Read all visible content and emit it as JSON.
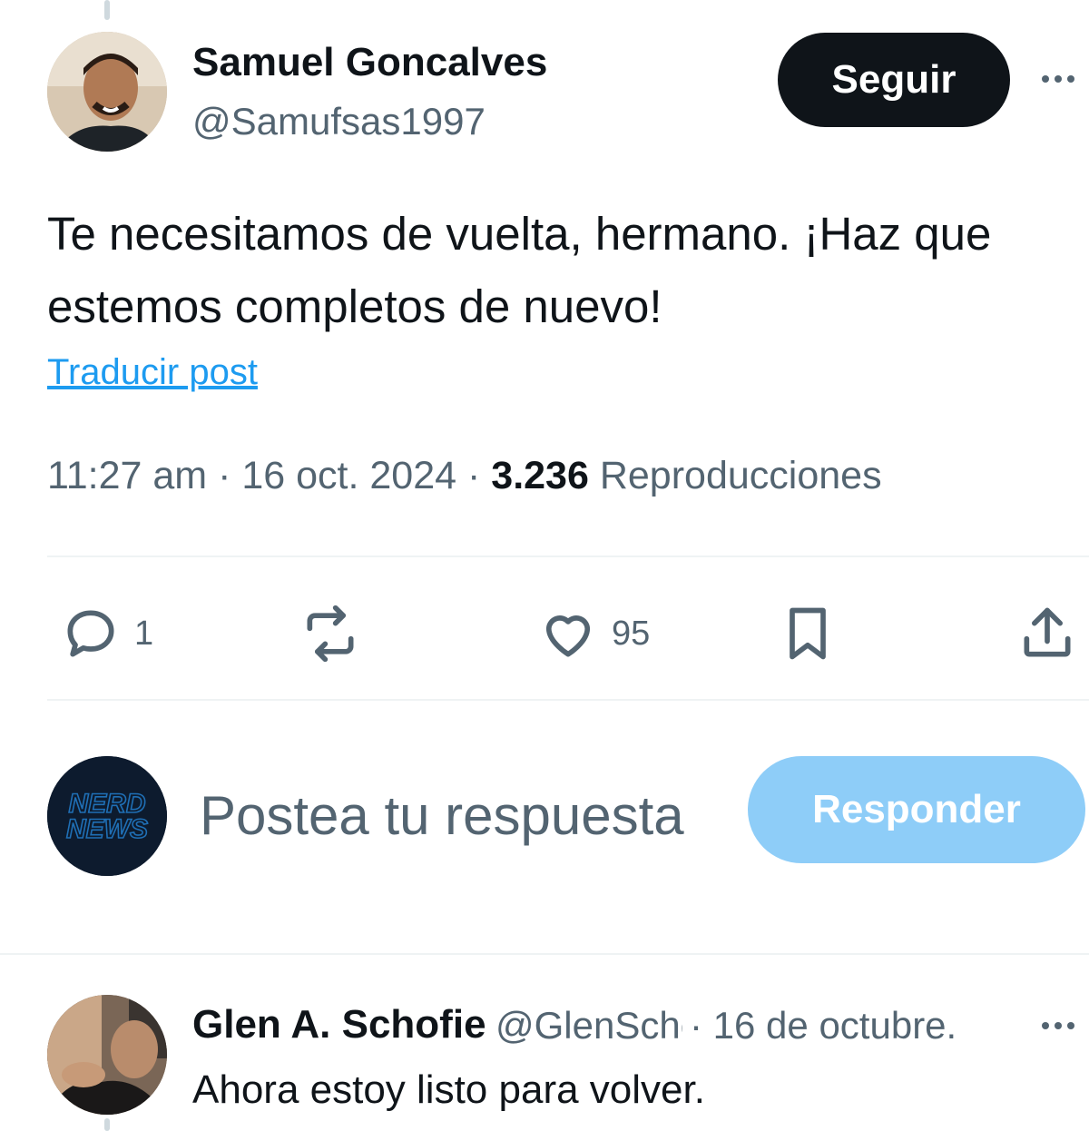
{
  "post": {
    "author_name": "Samuel Goncalves",
    "author_handle": "@Samufsas1997",
    "follow_label": "Seguir",
    "text": "Te necesitamos de vuelta, hermano. ¡Haz que estemos completos de nuevo!",
    "translate_label": "Traducir post",
    "time": "11:27 am",
    "separator": "·",
    "date": "16 oct. 2024",
    "views_count": "3.236",
    "views_label": "Reproducciones"
  },
  "actions": {
    "reply_count": "1",
    "repost_count": "",
    "like_count": "95"
  },
  "composer": {
    "avatar_text": "NERD NEWS",
    "placeholder": "Postea tu respuesta",
    "reply_label": "Responder"
  },
  "reply": {
    "author_name": "Glen A. Schofield",
    "author_handle": "@GlenSchofield",
    "separator": "·",
    "date": "16 de octubre.",
    "text": "Ahora estoy listo para volver."
  },
  "colors": {
    "accent": "#1d9bf0",
    "reply_button_disabled": "#8ecdf8",
    "secondary_text": "#536471",
    "primary_text": "#0f1419",
    "divider": "#eff3f4"
  },
  "icons": {
    "reply": "reply-icon",
    "repost": "repost-icon",
    "like": "heart-icon",
    "bookmark": "bookmark-icon",
    "share": "share-icon",
    "more": "more-icon"
  }
}
